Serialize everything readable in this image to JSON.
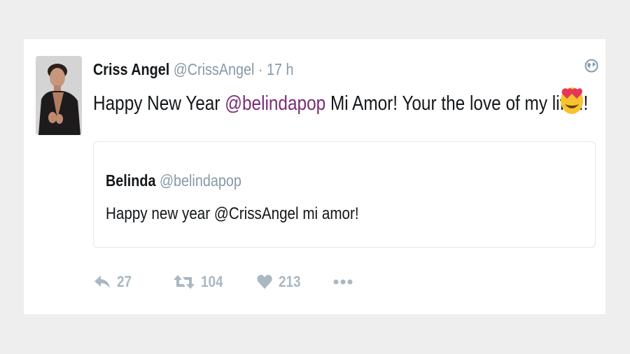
{
  "tweet": {
    "author_name": "Criss Angel",
    "author_handle": "@CrissAngel",
    "separator": "·",
    "time": "17 h",
    "text_before": "Happy New Year ",
    "mention": "@belindapop",
    "text_after": " Mi Amor! Your the love of my life!!!",
    "emoji": "smiling-face-with-heart-eyes"
  },
  "quoted_tweet": {
    "author_name": "Belinda",
    "author_handle": "@belindapop",
    "text": "Happy new year @CrissAngel mi amor!"
  },
  "actions": {
    "reply_count": "27",
    "retweet_count": "104",
    "like_count": "213"
  },
  "colors": {
    "mention": "#7b2b73",
    "muted": "#8899a6",
    "action_icons": "#aab8c2"
  }
}
